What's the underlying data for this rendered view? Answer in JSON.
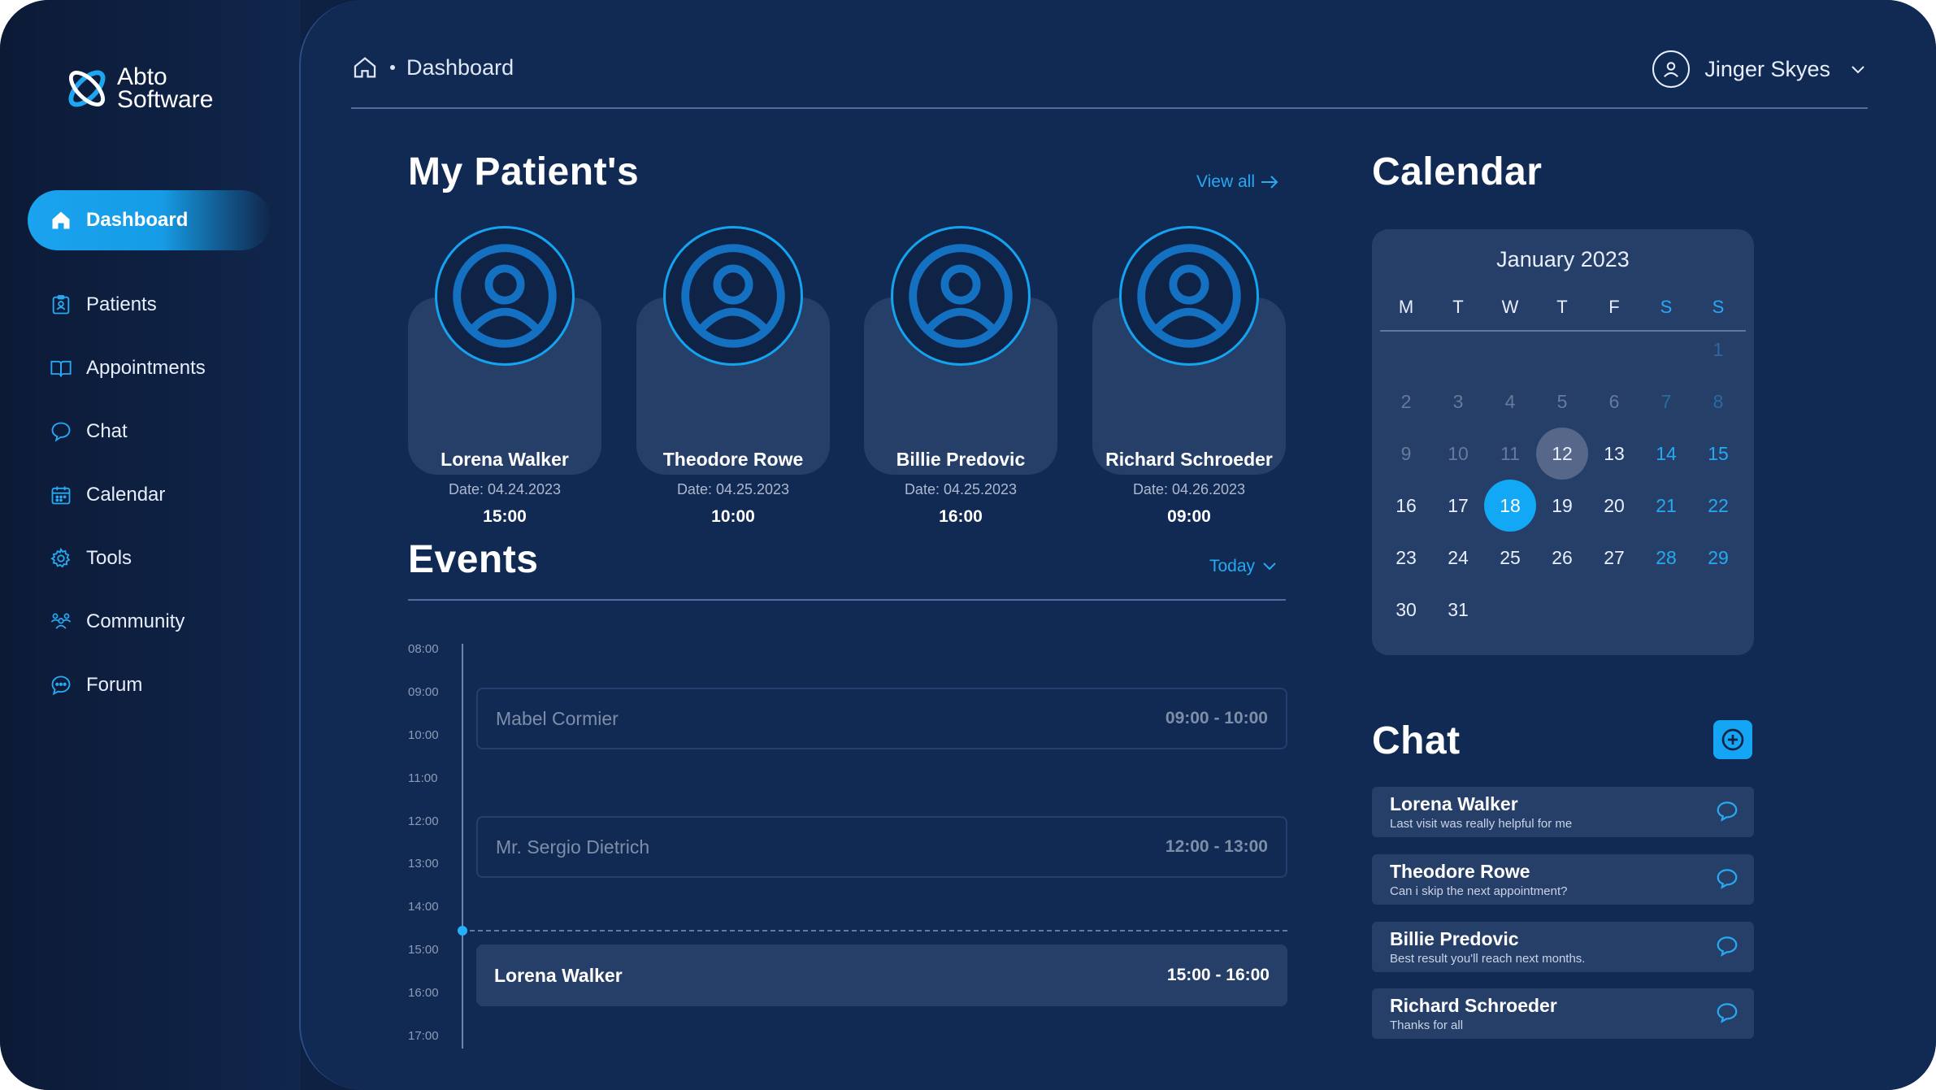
{
  "brand": {
    "line1": "Abto",
    "line2": "Software"
  },
  "sidebar": {
    "items": [
      {
        "label": "Dashboard",
        "icon": "home-icon",
        "active": true
      },
      {
        "label": "Patients",
        "icon": "patient-clipboard-icon"
      },
      {
        "label": "Appointments",
        "icon": "book-icon"
      },
      {
        "label": "Chat",
        "icon": "chat-bubble-icon"
      },
      {
        "label": "Calendar",
        "icon": "calendar-icon"
      },
      {
        "label": "Tools",
        "icon": "gear-icon"
      },
      {
        "label": "Community",
        "icon": "community-icon"
      },
      {
        "label": "Forum",
        "icon": "forum-icon"
      }
    ]
  },
  "header": {
    "breadcrumb": "Dashboard",
    "user_name": "Jinger Skyes"
  },
  "patients": {
    "title": "My Patient's",
    "view_all": "View all",
    "cards": [
      {
        "name": "Lorena Walker",
        "date": "Date: 04.24.2023",
        "time": "15:00"
      },
      {
        "name": "Theodore Rowe",
        "date": "Date: 04.25.2023",
        "time": "10:00"
      },
      {
        "name": "Billie Predovic",
        "date": "Date: 04.25.2023",
        "time": "16:00"
      },
      {
        "name": "Richard Schroeder",
        "date": "Date: 04.26.2023",
        "time": "09:00"
      }
    ]
  },
  "events": {
    "title": "Events",
    "filter": "Today",
    "hours": [
      "08:00",
      "09:00",
      "10:00",
      "11:00",
      "12:00",
      "13:00",
      "14:00",
      "15:00",
      "16:00",
      "17:00"
    ],
    "items": [
      {
        "name": "Mabel Cormier",
        "time": "09:00 - 10:00",
        "state": "past"
      },
      {
        "name": "Mr. Sergio Dietrich",
        "time": "12:00 - 13:00",
        "state": "past"
      },
      {
        "name": "Lorena Walker",
        "time": "15:00 - 16:00",
        "state": "current"
      }
    ]
  },
  "calendar": {
    "title": "Calendar",
    "month": "January",
    "year": "2023",
    "weekdays": [
      "M",
      "T",
      "W",
      "T",
      "F",
      "S",
      "S"
    ],
    "weeks": [
      [
        "",
        "",
        "",
        "",
        "",
        "",
        "1"
      ],
      [
        "2",
        "3",
        "4",
        "5",
        "6",
        "7",
        "8"
      ],
      [
        "9",
        "10",
        "11",
        "12",
        "13",
        "14",
        "15"
      ],
      [
        "16",
        "17",
        "18",
        "19",
        "20",
        "21",
        "22"
      ],
      [
        "23",
        "24",
        "25",
        "26",
        "27",
        "28",
        "29"
      ],
      [
        "30",
        "31",
        "",
        "",
        "",
        "",
        ""
      ]
    ],
    "today": "12",
    "selected": "18",
    "colors": {
      "accent": "#27a9f2",
      "selected": "#12a8f5",
      "today": "#56678a"
    }
  },
  "chat": {
    "title": "Chat",
    "items": [
      {
        "name": "Lorena Walker",
        "message": "Last visit was really helpful for me"
      },
      {
        "name": "Theodore Rowe",
        "message": "Can i skip the next appointment?"
      },
      {
        "name": "Billie Predovic",
        "message": "Best result you'll reach next months."
      },
      {
        "name": "Richard Schroeder",
        "message": "Thanks for all"
      }
    ]
  }
}
